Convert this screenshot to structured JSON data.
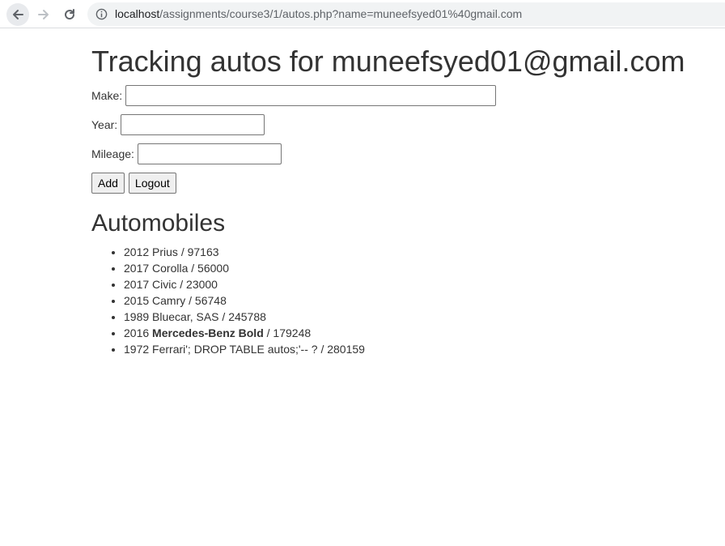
{
  "browser": {
    "url_host": "localhost",
    "url_path": "/assignments/course3/1/autos.php?name=muneefsyed01%40gmail.com"
  },
  "page": {
    "title": "Tracking autos for muneefsyed01@gmail.com",
    "form": {
      "make_label": "Make:",
      "make_value": "",
      "year_label": "Year:",
      "year_value": "",
      "mileage_label": "Mileage:",
      "mileage_value": "",
      "add_button": "Add",
      "logout_button": "Logout"
    },
    "list_heading": "Automobiles",
    "autos": [
      {
        "prefix": "2012 Prius / 97163",
        "bold": "",
        "suffix": ""
      },
      {
        "prefix": "2017 Corolla / 56000",
        "bold": "",
        "suffix": ""
      },
      {
        "prefix": "2017 Civic / 23000",
        "bold": "",
        "suffix": ""
      },
      {
        "prefix": "2015 Camry / 56748",
        "bold": "",
        "suffix": ""
      },
      {
        "prefix": "1989 Bluecar, SAS / 245788",
        "bold": "",
        "suffix": ""
      },
      {
        "prefix": "2016 ",
        "bold": "Mercedes-Benz Bold",
        "suffix": " / 179248"
      },
      {
        "prefix": "1972 Ferrari'; DROP TABLE autos;'-- ? / 280159",
        "bold": "",
        "suffix": ""
      }
    ]
  }
}
